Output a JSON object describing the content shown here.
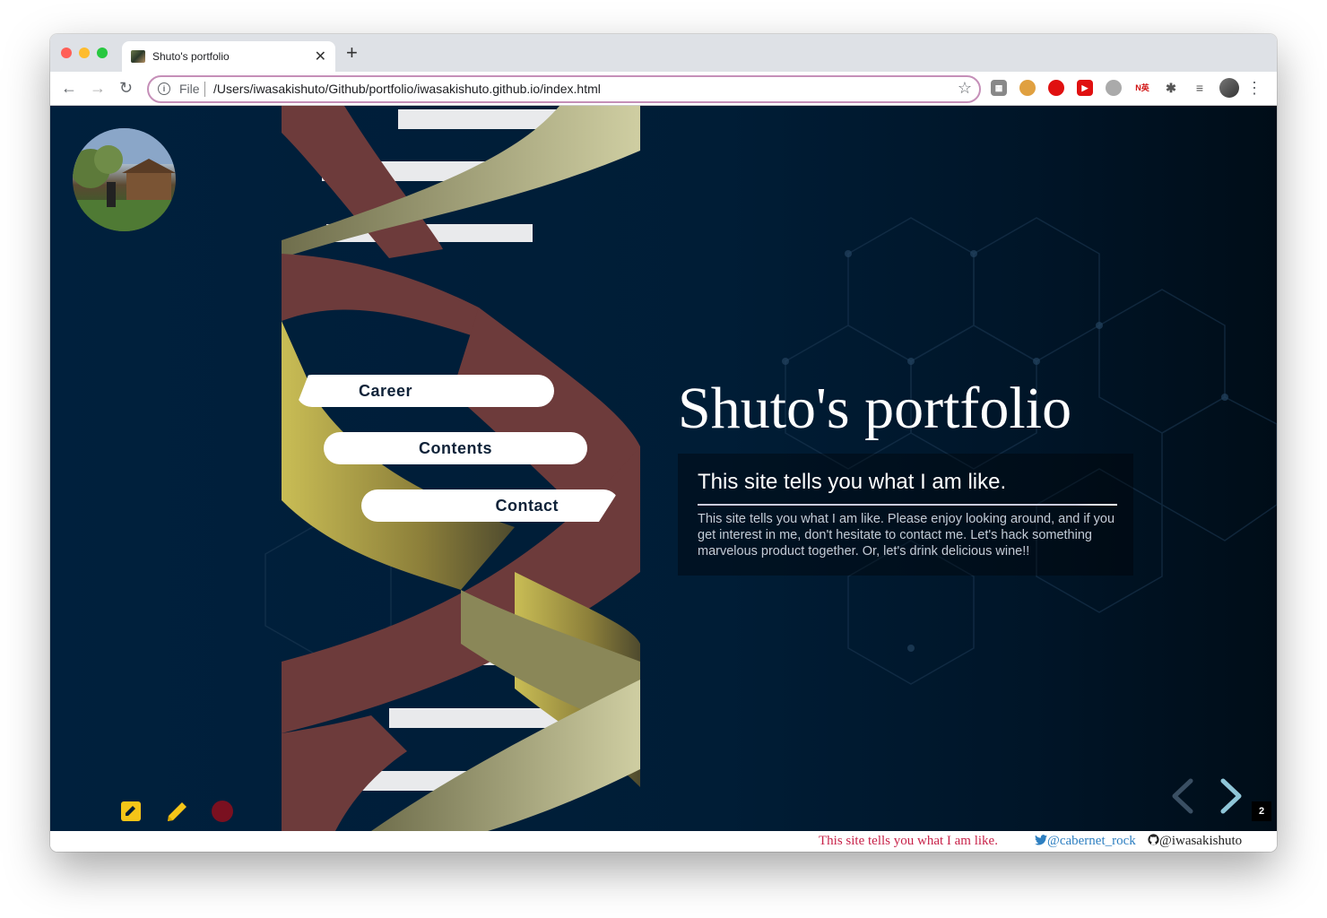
{
  "browser": {
    "tab_title": "Shuto's portfolio",
    "url_scheme": "File",
    "url": "/Users/iwasakishuto/Github/portfolio/iwasakishuto.github.io/index.html",
    "extensions": [
      "qr-icon",
      "cookie-icon",
      "opera-icon",
      "youtube-icon",
      "speed-icon",
      "translate-icon",
      "puzzle-icon",
      "playlist-icon",
      "profile-avatar"
    ],
    "ext_translate_label": "N英"
  },
  "menu": {
    "career": "Career",
    "contents": "Contents",
    "contact": "Contact"
  },
  "hero": {
    "title": "Shuto's portfolio",
    "tagline": "This site tells you what I am like.",
    "description": "This site tells you what I am like. Please enjoy looking around, and if you get interest in me, don't hesitate to contact me. Let's hack something marvelous product together. Or, let's drink delicious wine!!"
  },
  "tools": {
    "note_icon": "note-edit-icon",
    "pencil_icon": "pencil-icon",
    "record_icon": "record-dot-icon"
  },
  "slide_nav": {
    "slide_number": "2"
  },
  "footer": {
    "tagline": "This site tells you what I am like.",
    "twitter": "@cabernet_rock",
    "github": "@iwasakishuto"
  },
  "colors": {
    "background": "#00203d",
    "accent_yellow": "#f5c518",
    "record_red": "#7a1020",
    "footer_tagline": "#c8234a",
    "twitter_blue": "#2d7fc1"
  }
}
